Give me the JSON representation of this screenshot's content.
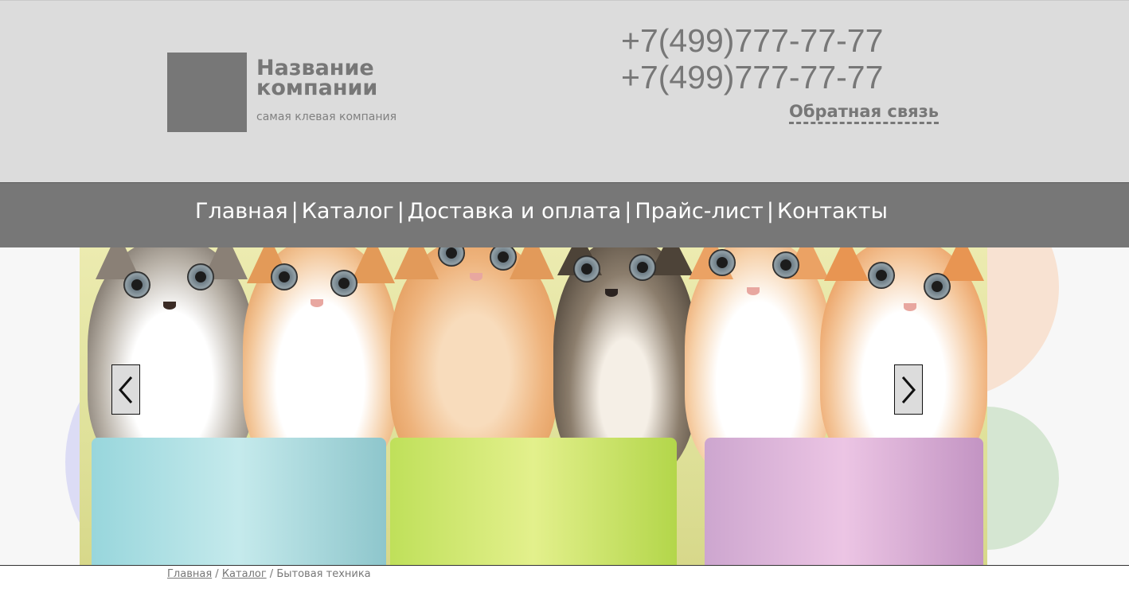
{
  "header": {
    "company_name": "Название компании",
    "tagline": "самая клевая компания",
    "phones": [
      "+7(499)777-77-77",
      "+7(499)777-77-77"
    ],
    "feedback_label": "Обратная связь"
  },
  "nav": {
    "items": [
      {
        "label": "Главная"
      },
      {
        "label": "Каталог"
      },
      {
        "label": "Доставка и оплата"
      },
      {
        "label": "Прайс-лист"
      },
      {
        "label": "Контакты"
      }
    ],
    "separator": "|"
  },
  "slider": {
    "image": "kittens-in-pots",
    "prev_icon": "chevron-left-icon",
    "next_icon": "chevron-right-icon"
  },
  "breadcrumb": {
    "items": [
      {
        "label": "Главная"
      },
      {
        "label": "Каталог"
      },
      {
        "label": "Бытовая техника"
      }
    ],
    "separator": "/"
  },
  "colors": {
    "header_bg": "#dcdcdc",
    "nav_bg": "#777777",
    "text_gray": "#777777"
  }
}
